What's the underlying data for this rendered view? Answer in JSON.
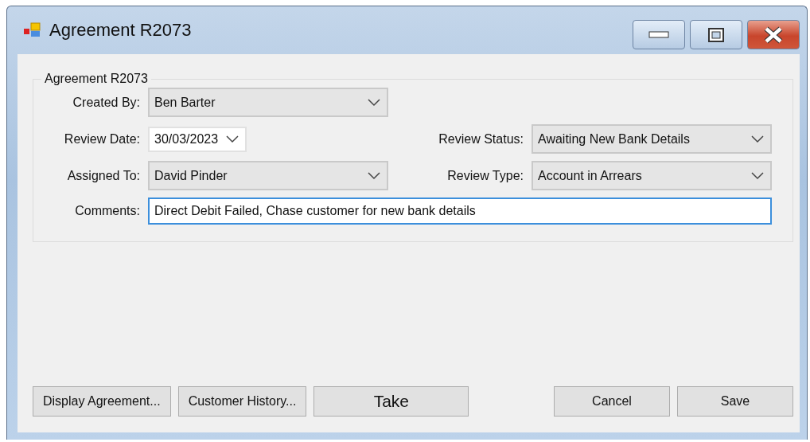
{
  "window": {
    "title": "Agreement R2073",
    "controls": [
      {
        "kind": "minimize"
      },
      {
        "kind": "maximize"
      },
      {
        "kind": "close"
      }
    ]
  },
  "group": {
    "title": "Agreement R2073",
    "rows": [
      [
        {
          "label": "Created By:",
          "value": "Ben Barter",
          "kind": "combo"
        }
      ],
      [
        {
          "label": "Review Date:",
          "value": "30/03/2023",
          "kind": "date"
        },
        {
          "label": "Review Status:",
          "value": "Awaiting New Bank Details",
          "kind": "combo"
        }
      ],
      [
        {
          "label": "Assigned To:",
          "value": "David Pinder",
          "kind": "combo"
        },
        {
          "label": "Review Type:",
          "value": "Account in Arrears",
          "kind": "combo"
        }
      ],
      [
        {
          "label": "Comments:",
          "value": "Direct Debit Failed, Chase customer for new bank details",
          "kind": "text"
        }
      ]
    ]
  },
  "buttons": {
    "left": [
      {
        "label": "Display Agreement...",
        "large": false
      },
      {
        "label": "Customer History...",
        "large": false
      },
      {
        "label": "Take",
        "large": true
      }
    ],
    "right": [
      {
        "label": "Cancel",
        "large": false
      },
      {
        "label": "Save",
        "large": false
      }
    ]
  }
}
